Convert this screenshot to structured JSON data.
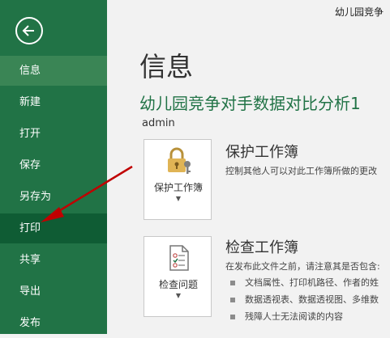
{
  "window": {
    "title": "幼儿园竞争"
  },
  "sidebar": {
    "items": [
      {
        "label": "信息"
      },
      {
        "label": "新建"
      },
      {
        "label": "打开"
      },
      {
        "label": "保存"
      },
      {
        "label": "另存为"
      },
      {
        "label": "打印"
      },
      {
        "label": "共享"
      },
      {
        "label": "导出"
      },
      {
        "label": "发布"
      }
    ]
  },
  "main": {
    "page_title": "信息",
    "workbook_name": "幼儿园竞争对手数据对比分析1",
    "owner": "admin",
    "protect": {
      "button_label": "保护工作簿",
      "heading": "保护工作簿",
      "description": "控制其他人可以对此工作簿所做的更改"
    },
    "inspect": {
      "button_label": "检查问题",
      "heading": "检查工作簿",
      "description": "在发布此文件之前，请注意其是否包含:",
      "bullets": [
        "文档属性、打印机路径、作者的姓",
        "数据透视表、数据透视图、多维数",
        "残障人士无法阅读的内容"
      ]
    }
  },
  "colors": {
    "accent": "#217346",
    "annotation_arrow": "#c00000"
  }
}
